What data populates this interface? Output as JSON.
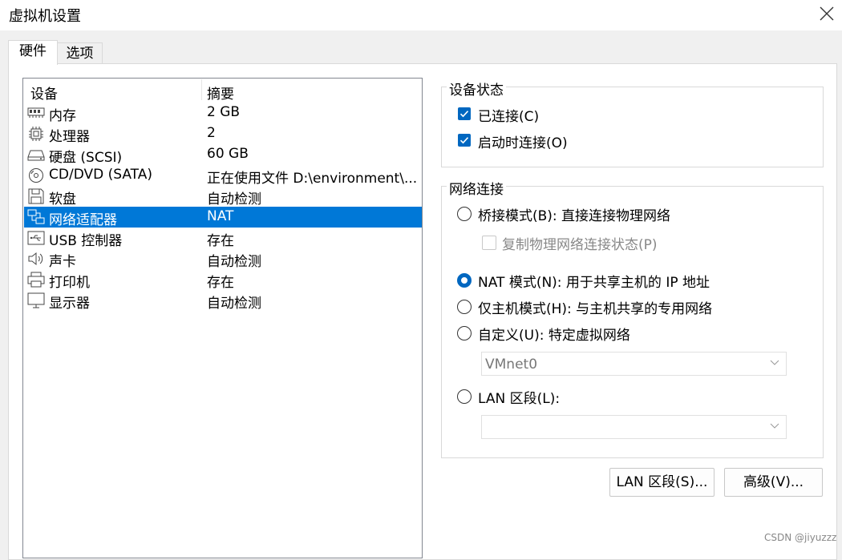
{
  "window": {
    "title": "虚拟机设置"
  },
  "tabs": [
    {
      "label": "硬件"
    },
    {
      "label": "选项"
    }
  ],
  "device_list": {
    "columns": {
      "device": "设备",
      "summary": "摘要"
    },
    "rows": [
      {
        "icon": "memory-icon",
        "device": "内存",
        "summary": "2 GB"
      },
      {
        "icon": "cpu-icon",
        "device": "处理器",
        "summary": "2"
      },
      {
        "icon": "harddisk-icon",
        "device": "硬盘 (SCSI)",
        "summary": "60 GB"
      },
      {
        "icon": "cd-dvd-icon",
        "device": "CD/DVD (SATA)",
        "summary": "正在使用文件 D:\\environment\\..."
      },
      {
        "icon": "floppy-icon",
        "device": "软盘",
        "summary": "自动检测"
      },
      {
        "icon": "network-adapter-icon",
        "device": "网络适配器",
        "summary": "NAT",
        "selected": true
      },
      {
        "icon": "usb-icon",
        "device": "USB 控制器",
        "summary": "存在"
      },
      {
        "icon": "speaker-icon",
        "device": "声卡",
        "summary": "自动检测"
      },
      {
        "icon": "printer-icon",
        "device": "打印机",
        "summary": "存在"
      },
      {
        "icon": "monitor-icon",
        "device": "显示器",
        "summary": "自动检测"
      }
    ]
  },
  "device_status": {
    "title": "设备状态",
    "connected": {
      "label": "已连接(C)",
      "checked": true
    },
    "connect_at_power_on": {
      "label": "启动时连接(O)",
      "checked": true
    }
  },
  "network_connection": {
    "title": "网络连接",
    "bridged": {
      "label": "桥接模式(B): 直接连接物理网络",
      "selected": false
    },
    "replicate": {
      "label": "复制物理网络连接状态(P)",
      "checked": false,
      "enabled": false
    },
    "nat": {
      "label": "NAT 模式(N): 用于共享主机的 IP 地址",
      "selected": true
    },
    "host_only": {
      "label": "仅主机模式(H): 与主机共享的专用网络",
      "selected": false
    },
    "custom": {
      "label": "自定义(U): 特定虚拟网络",
      "selected": false
    },
    "custom_select": {
      "value": "VMnet0"
    },
    "lan_segment": {
      "label": "LAN 区段(L):",
      "selected": false
    },
    "lan_select": {
      "value": ""
    }
  },
  "buttons": {
    "lan_segments": "LAN 区段(S)...",
    "advanced": "高级(V)..."
  },
  "watermark": "CSDN @jiyuzzz",
  "colors": {
    "accent": "#0067c0",
    "selection": "#0078d7"
  }
}
